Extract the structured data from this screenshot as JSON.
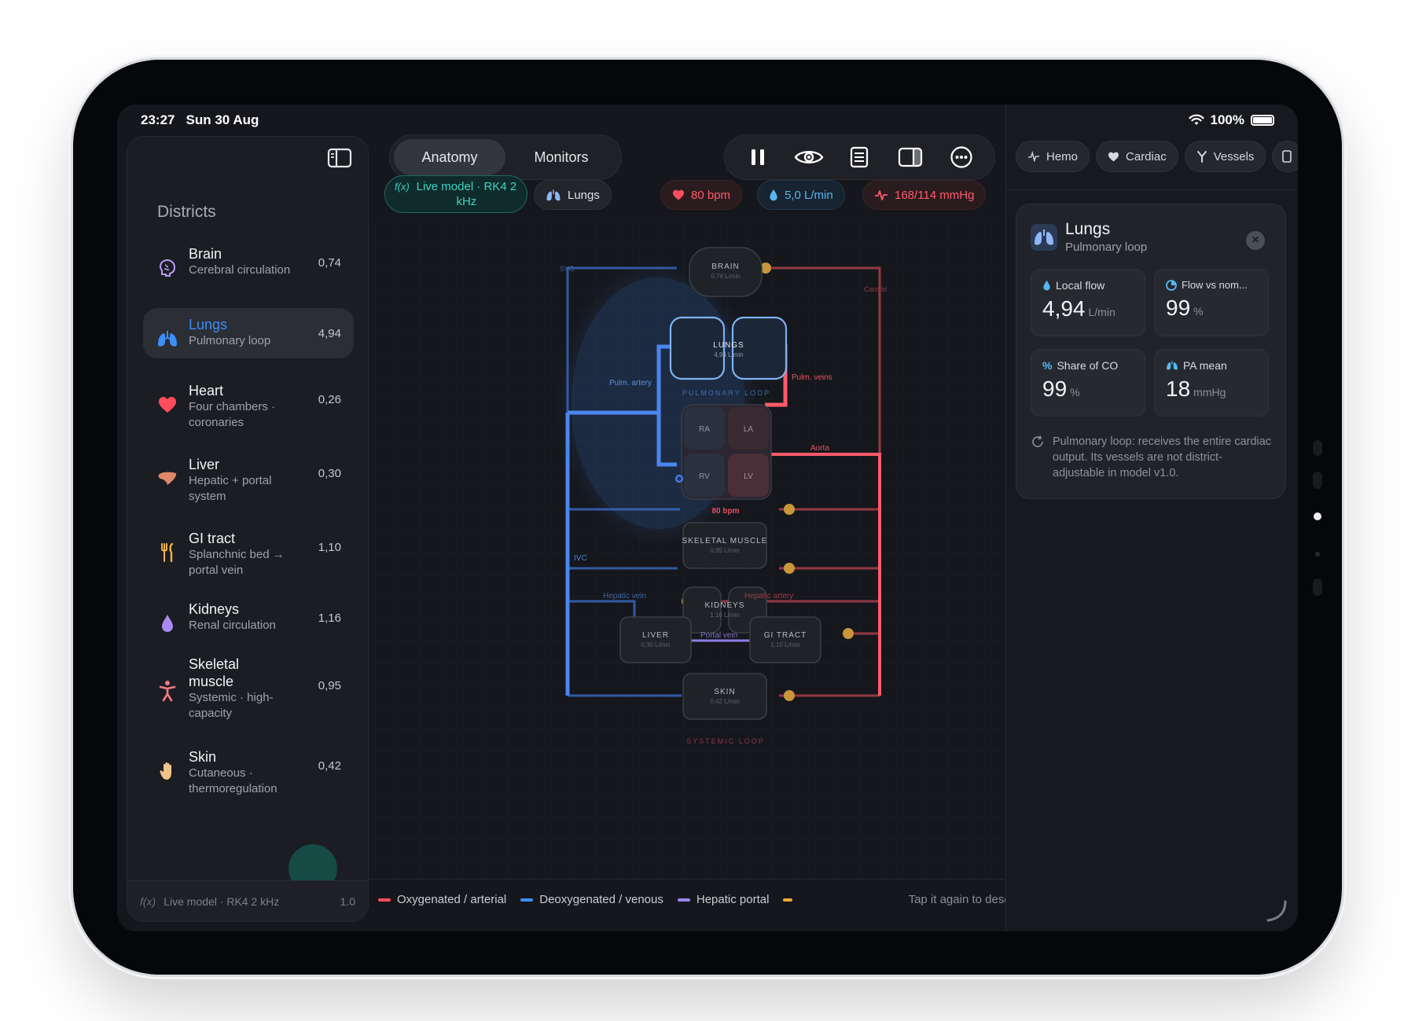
{
  "status": {
    "time": "23:27",
    "date": "Sun 30 Aug",
    "battery": "100%"
  },
  "sidebar": {
    "title": "Districts",
    "items": [
      {
        "name": "Brain",
        "sub": "Cerebral circulation",
        "value": "0,74",
        "icon": "brain-icon",
        "color": "#b79bf5"
      },
      {
        "name": "Lungs",
        "sub": "Pulmonary loop",
        "value": "4,94",
        "icon": "lungs-icon",
        "color": "#3e8ef7"
      },
      {
        "name": "Heart",
        "sub": "Four chambers · coronaries",
        "value": "0,26",
        "icon": "heart-icon",
        "color": "#ff4d5e"
      },
      {
        "name": "Liver",
        "sub": "Hepatic + portal system",
        "value": "0,30",
        "icon": "liver-icon",
        "color": "#e0876a"
      },
      {
        "name": "GI tract",
        "sub": "Splanchnic bed → portal vein",
        "value": "1,10",
        "icon": "fork-knife-icon",
        "color": "#f1b548"
      },
      {
        "name": "Kidneys",
        "sub": "Renal circulation",
        "value": "1,16",
        "icon": "drop-icon",
        "color": "#a98af2"
      },
      {
        "name": "Skeletal muscle",
        "sub": "Systemic · high-capacity",
        "value": "0,95",
        "icon": "figure-icon",
        "color": "#f07b86"
      },
      {
        "name": "Skin",
        "sub": "Cutaneous · thermoregulation",
        "value": "0,42",
        "icon": "hand-icon",
        "color": "#f0c48a"
      }
    ],
    "footer": {
      "fx": "f(x)",
      "label": "Live model · RK4 2 kHz",
      "version": "1.0"
    }
  },
  "toolbar": {
    "segments": [
      "Anatomy",
      "Monitors"
    ],
    "icons": [
      "pause-icon",
      "eye-icon",
      "notes-icon",
      "sidebar-right-icon",
      "more-icon"
    ]
  },
  "chips": {
    "live": "Live model · RK4 2 kHz",
    "fx": "f(x)",
    "selection": "Lungs",
    "heart_rate": "80 bpm",
    "cardiac_output": "5,0 L/min",
    "pressure": "168/114 mmHg"
  },
  "diagram": {
    "nodes": {
      "brain": {
        "label": "BRAIN",
        "flow": "0,74 L/min"
      },
      "lungs": {
        "label": "LUNGS",
        "flow": "4,94 L/min"
      },
      "skeletal": {
        "label": "SKELETAL MUSCLE",
        "flow": "0,95 L/min"
      },
      "kidneys": {
        "label": "KIDNEYS",
        "flow": "1,16 L/min"
      },
      "liver": {
        "label": "LIVER",
        "flow": "0,30 L/min"
      },
      "gi": {
        "label": "GI TRACT",
        "flow": "1,10 L/min"
      },
      "skin": {
        "label": "SKIN",
        "flow": "0,42 L/min"
      }
    },
    "chambers": [
      "RA",
      "LA",
      "RV",
      "LV"
    ],
    "labels": {
      "svc": "SVC",
      "carotid": "Carotid",
      "pulm_artery": "Pulm. artery",
      "pulm_veins": "Pulm. veins",
      "pulmonary_loop": "PULMONARY LOOP",
      "aorta": "Aorta",
      "heart_rate": "80 bpm",
      "ivc": "IVC",
      "hepatic_vein": "Hepatic vein",
      "hepatic_artery": "Hepatic artery",
      "portal_vein": "Portal vein",
      "systemic_loop": "SYSTEMIC LOOP"
    },
    "colors": {
      "arterial": "#ff5a6a",
      "venous": "#3e8ef7",
      "portal": "#9b86f0",
      "valve": "#c9973a"
    }
  },
  "legend": {
    "items": [
      {
        "label": "Oxygenated / arterial",
        "color": "#ff4d5e"
      },
      {
        "label": "Deoxygenated / venous",
        "color": "#3e8ef7"
      },
      {
        "label": "Hepatic portal",
        "color": "#9b86f0"
      },
      {
        "label": "",
        "color": "#f1a83a"
      }
    ],
    "hint": "Tap it again to deselect"
  },
  "rpanel": {
    "tabs": [
      {
        "label": "Hemo",
        "icon": "pulse-icon"
      },
      {
        "label": "Cardiac",
        "icon": "heart-icon"
      },
      {
        "label": "Vessels",
        "icon": "vessels-icon"
      }
    ],
    "card": {
      "title": "Lungs",
      "subtitle": "Pulmonary loop",
      "metrics": [
        {
          "label": "Local flow",
          "value": "4,94",
          "unit": "L/min",
          "icon": "drop-icon"
        },
        {
          "label": "Flow vs nom...",
          "value": "99",
          "unit": "%",
          "icon": "gauge-icon"
        },
        {
          "label": "Share of CO",
          "value": "99",
          "unit": "%",
          "icon": "percent-icon"
        },
        {
          "label": "PA mean",
          "value": "18",
          "unit": "mmHg",
          "icon": "lungs-icon"
        }
      ],
      "note": "Pulmonary loop: receives the entire cardiac output. Its vessels are not district-adjustable in model v1.0."
    }
  }
}
